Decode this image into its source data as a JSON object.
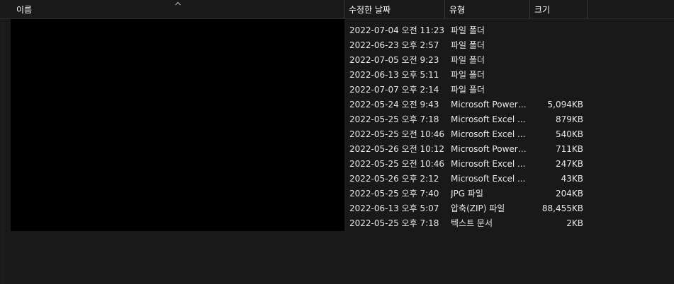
{
  "columns": {
    "name": "이름",
    "date": "수정한 날짜",
    "type": "유형",
    "size": "크기"
  },
  "rows": [
    {
      "date": "2022-07-04 오전 11:23",
      "type": "파일 폴더",
      "size": ""
    },
    {
      "date": "2022-06-23 오후 2:57",
      "type": "파일 폴더",
      "size": ""
    },
    {
      "date": "2022-07-05 오전 9:23",
      "type": "파일 폴더",
      "size": ""
    },
    {
      "date": "2022-06-13 오후 5:11",
      "type": "파일 폴더",
      "size": ""
    },
    {
      "date": "2022-07-07 오후 2:14",
      "type": "파일 폴더",
      "size": ""
    },
    {
      "date": "2022-05-24 오전 9:43",
      "type": "Microsoft PowerP...",
      "size": "5,094KB"
    },
    {
      "date": "2022-05-25 오후 7:18",
      "type": "Microsoft Excel ...",
      "size": "879KB"
    },
    {
      "date": "2022-05-25 오전 10:46",
      "type": "Microsoft Excel ...",
      "size": "540KB"
    },
    {
      "date": "2022-05-26 오전 10:12",
      "type": "Microsoft PowerP...",
      "size": "711KB"
    },
    {
      "date": "2022-05-25 오전 10:46",
      "type": "Microsoft Excel ...",
      "size": "247KB"
    },
    {
      "date": "2022-05-26 오후 2:12",
      "type": "Microsoft Excel ...",
      "size": "43KB"
    },
    {
      "date": "2022-05-25 오후 7:40",
      "type": "JPG 파일",
      "size": "204KB"
    },
    {
      "date": "2022-06-13 오후 5:07",
      "type": "압축(ZIP) 파일",
      "size": "88,455KB"
    },
    {
      "date": "2022-05-25 오후 7:18",
      "type": "텍스트 문서",
      "size": "2KB"
    }
  ],
  "icons": {
    "sort": "sort-ascending-arrow-icon"
  },
  "colors": {
    "background": "#191919",
    "redacted": "#000000",
    "text": "#e8e8e8"
  }
}
